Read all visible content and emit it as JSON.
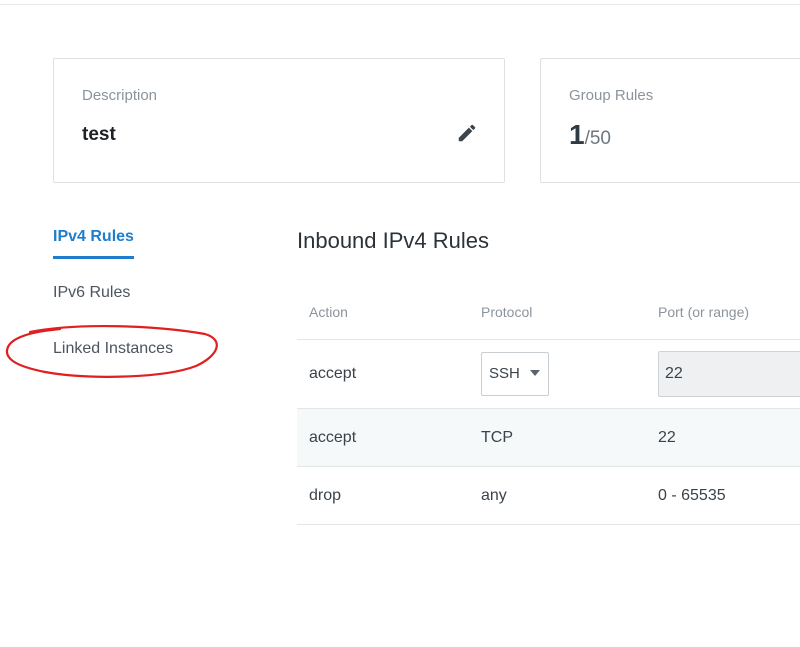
{
  "summary": {
    "description_label": "Description",
    "description_value": "test",
    "group_rules_label": "Group Rules",
    "group_rules_count": "1",
    "group_rules_limit": "/50"
  },
  "side_nav": {
    "items": [
      {
        "label": "IPv4 Rules",
        "active": true
      },
      {
        "label": "IPv6 Rules",
        "active": false
      },
      {
        "label": "Linked Instances",
        "active": false
      }
    ]
  },
  "section": {
    "title": "Inbound IPv4 Rules"
  },
  "table": {
    "headers": [
      "Action",
      "Protocol",
      "Port (or range)"
    ],
    "edit_row": {
      "action": "accept",
      "protocol_selected": "SSH",
      "port_value": "22"
    },
    "rows": [
      {
        "action": "accept",
        "protocol": "TCP",
        "port": "22"
      },
      {
        "action": "drop",
        "protocol": "any",
        "port": "0 - 65535"
      }
    ]
  },
  "colors": {
    "accent": "#1f7ecb",
    "annotation": "#e01f1f"
  },
  "icons": {
    "edit": "pencil-icon",
    "dropdown": "caret-down-icon"
  }
}
